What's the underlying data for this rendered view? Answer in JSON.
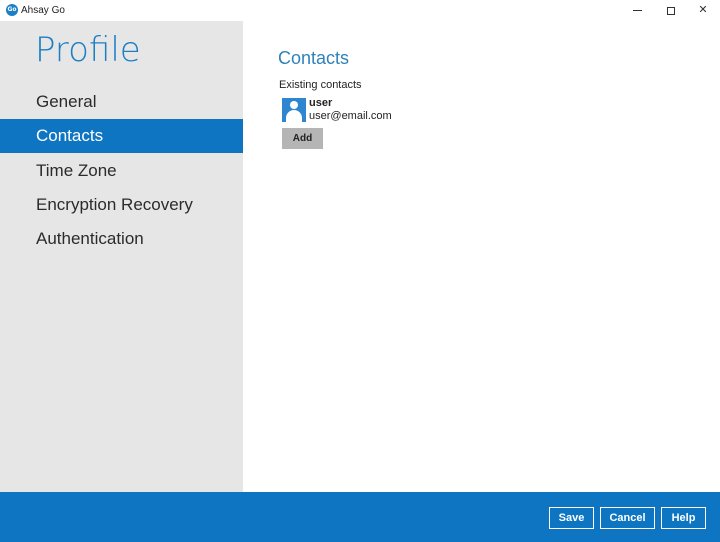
{
  "window": {
    "logo_text": "Go",
    "title": "Ahsay Go",
    "controls": {
      "minimize": "minimize-icon",
      "maximize": "maximize-icon",
      "close": "close-icon"
    },
    "close_glyph": "✕"
  },
  "sidebar": {
    "title": "Profile",
    "items": [
      {
        "label": "General",
        "active": false
      },
      {
        "label": "Contacts",
        "active": true
      },
      {
        "label": "Time Zone",
        "active": false
      },
      {
        "label": "Encryption Recovery",
        "active": false
      },
      {
        "label": "Authentication",
        "active": false
      }
    ]
  },
  "main": {
    "title": "Contacts",
    "existing_label": "Existing contacts",
    "contacts": [
      {
        "name": "user",
        "email": "user@email.com",
        "icon": "person-icon"
      }
    ],
    "add_label": "Add"
  },
  "footer": {
    "save_label": "Save",
    "cancel_label": "Cancel",
    "help_label": "Help"
  },
  "colors": {
    "accent": "#0e75c2",
    "sidebar_bg": "#e6e6e6",
    "title_blue": "#2f82b9",
    "button_gray": "#b5b5b5"
  }
}
